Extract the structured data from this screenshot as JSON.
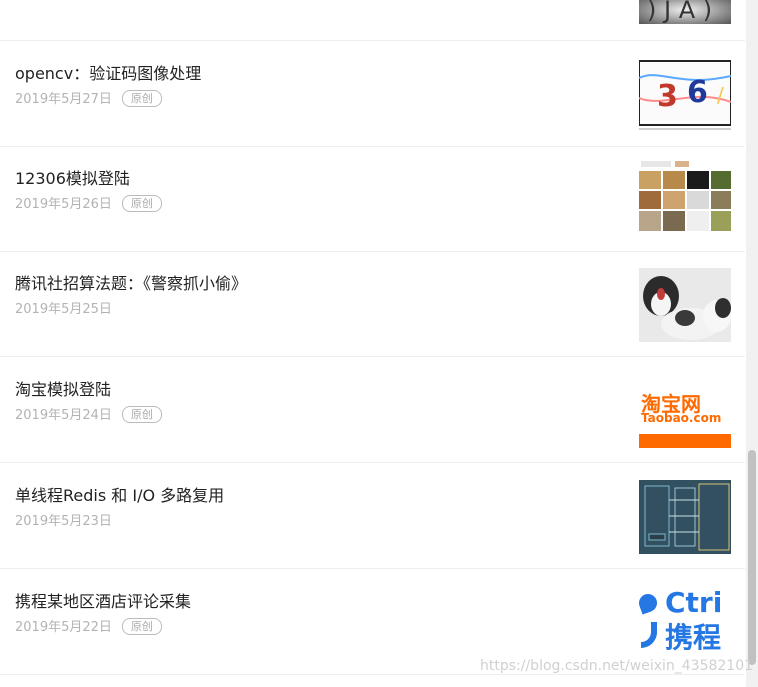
{
  "articles": [
    {
      "title": "",
      "date": "",
      "badge": "",
      "thumb": "captcha-dark"
    },
    {
      "title": "opencv：验证码图像处理",
      "date": "2019年5月27日",
      "badge": "原创",
      "thumb": "captcha-digits",
      "thumb_text": "36"
    },
    {
      "title": "12306模拟登陆",
      "date": "2019年5月26日",
      "badge": "原创",
      "thumb": "image-grid"
    },
    {
      "title": "腾讯社招算法题：《警察抓小偷》",
      "date": "2019年5月25日",
      "badge": "",
      "thumb": "puppies"
    },
    {
      "title": "淘宝模拟登陆",
      "date": "2019年5月24日",
      "badge": "原创",
      "thumb": "taobao-logo",
      "thumb_text": "淘宝网",
      "thumb_subtext": "Taobao.com"
    },
    {
      "title": "单线程Redis 和 I/O 多路复用",
      "date": "2019年5月23日",
      "badge": "",
      "thumb": "diagram"
    },
    {
      "title": "携程某地区酒店评论采集",
      "date": "2019年5月22日",
      "badge": "原创",
      "thumb": "ctrip-logo",
      "thumb_text": "Ctri",
      "thumb_subtext": "携程"
    }
  ],
  "watermark": "https://blog.csdn.net/weixin_43582101",
  "colors": {
    "title": "#222222",
    "meta": "#b3b3b3",
    "taobao": "#ff6a00",
    "ctrip": "#2577e3"
  }
}
